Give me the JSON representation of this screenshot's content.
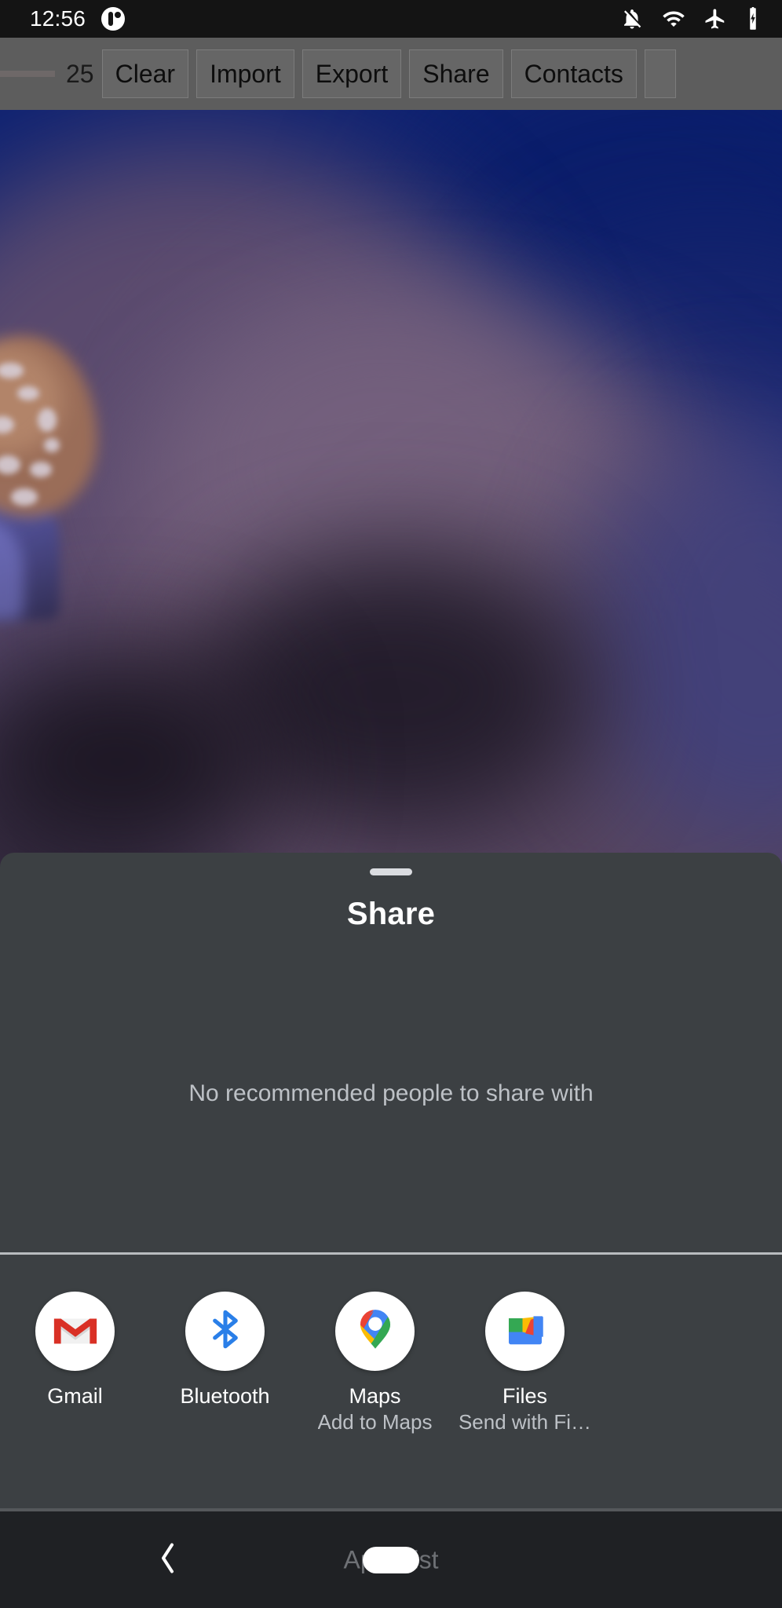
{
  "status_bar": {
    "time": "12:56",
    "icons": [
      {
        "name": "notifications-off-icon"
      },
      {
        "name": "wifi-icon"
      },
      {
        "name": "airplane-mode-icon"
      },
      {
        "name": "battery-charging-icon"
      }
    ],
    "badge_icon": "app-notification-badge-icon",
    "background_color": "#141414"
  },
  "app_toolbar": {
    "count_label": "25",
    "buttons": [
      {
        "label": "Clear"
      },
      {
        "label": "Import"
      },
      {
        "label": "Export"
      },
      {
        "label": "Share"
      },
      {
        "label": "Contacts"
      },
      {
        "label": ""
      }
    ],
    "background_color": "#5d5d5d"
  },
  "wallpaper": {
    "description": "blurred jellyfish photograph",
    "colors": {
      "top": "#0e2272",
      "mid": "#6a5572",
      "bottom": "#4b3d55",
      "jellyfish_bell": "#9e6f57",
      "jellyfish_tentacles": "#6b6bbf"
    }
  },
  "share_sheet": {
    "title": "Share",
    "empty_state_text": "No recommended people to share with",
    "background_color": "#3c4043",
    "drag_handle_color": "#dadce0",
    "apps": [
      {
        "label": "Gmail",
        "sublabel": "",
        "icon": "gmail-icon",
        "icon_color": "#d93025"
      },
      {
        "label": "Bluetooth",
        "sublabel": "",
        "icon": "bluetooth-icon",
        "icon_color": "#2a7fe8"
      },
      {
        "label": "Maps",
        "sublabel": "Add to Maps",
        "icon": "google-maps-pin-icon",
        "icon_color": "#34a853"
      },
      {
        "label": "Files",
        "sublabel": "Send with Fi…",
        "icon": "files-by-google-icon",
        "icon_color": "#4285f4"
      }
    ]
  },
  "nav_bar": {
    "back_label": "back-chevron",
    "apps_list_label": "Apps list",
    "home_pill": "home-pill",
    "background_color": "#1f2124"
  }
}
